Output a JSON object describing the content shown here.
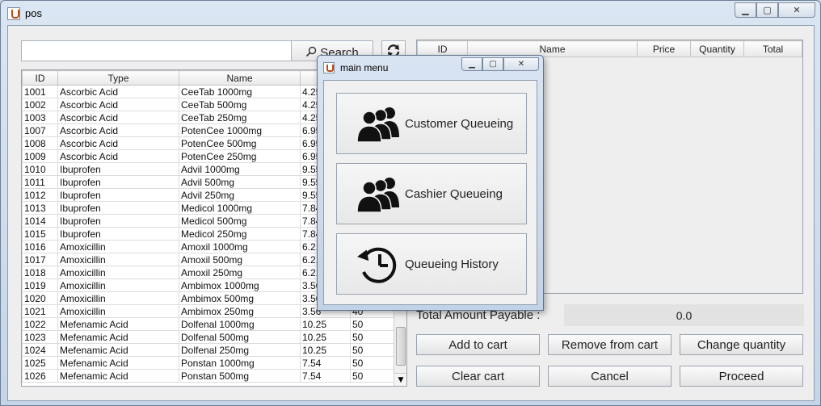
{
  "window": {
    "title": "pos"
  },
  "search": {
    "value": "",
    "button_label": "Search"
  },
  "products": {
    "columns": [
      "ID",
      "Type",
      "Name",
      "",
      ""
    ],
    "rows": [
      [
        "1001",
        "Ascorbic Acid",
        "CeeTab 1000mg",
        "4.25",
        ""
      ],
      [
        "1002",
        "Ascorbic Acid",
        "CeeTab 500mg",
        "4.25",
        ""
      ],
      [
        "1003",
        "Ascorbic Acid",
        "CeeTab 250mg",
        "4.25",
        ""
      ],
      [
        "1007",
        "Ascorbic Acid",
        "PotenCee 1000mg",
        "6.95",
        ""
      ],
      [
        "1008",
        "Ascorbic Acid",
        "PotenCee 500mg",
        "6.95",
        ""
      ],
      [
        "1009",
        "Ascorbic Acid",
        "PotenCee 250mg",
        "6.95",
        ""
      ],
      [
        "1010",
        "Ibuprofen",
        "Advil 1000mg",
        "9.55",
        ""
      ],
      [
        "1011",
        "Ibuprofen",
        "Advil 500mg",
        "9.55",
        ""
      ],
      [
        "1012",
        "Ibuprofen",
        "Advil 250mg",
        "9.55",
        ""
      ],
      [
        "1013",
        "Ibuprofen",
        "Medicol 1000mg",
        "7.84",
        ""
      ],
      [
        "1014",
        "Ibuprofen",
        "Medicol 500mg",
        "7.84",
        ""
      ],
      [
        "1015",
        "Ibuprofen",
        "Medicol 250mg",
        "7.84",
        ""
      ],
      [
        "1016",
        "Amoxicillin",
        "Amoxil 1000mg",
        "6.21",
        ""
      ],
      [
        "1017",
        "Amoxicillin",
        "Amoxil 500mg",
        "6.21",
        ""
      ],
      [
        "1018",
        "Amoxicillin",
        "Amoxil 250mg",
        "6.21",
        ""
      ],
      [
        "1019",
        "Amoxicillin",
        "Ambimox 1000mg",
        "3.56",
        ""
      ],
      [
        "1020",
        "Amoxicillin",
        "Ambimox 500mg",
        "3.56",
        ""
      ],
      [
        "1021",
        "Amoxicillin",
        "Ambimox 250mg",
        "3.56",
        "40"
      ],
      [
        "1022",
        "Mefenamic Acid",
        "Dolfenal 1000mg",
        "10.25",
        "50"
      ],
      [
        "1023",
        "Mefenamic Acid",
        "Dolfenal 500mg",
        "10.25",
        "50"
      ],
      [
        "1024",
        "Mefenamic Acid",
        "Dolfenal 250mg",
        "10.25",
        "50"
      ],
      [
        "1025",
        "Mefenamic Acid",
        "Ponstan 1000mg",
        "7.54",
        "50"
      ],
      [
        "1026",
        "Mefenamic Acid",
        "Ponstan 500mg",
        "7.54",
        "50"
      ]
    ]
  },
  "cart": {
    "columns": [
      "ID",
      "Name",
      "Price",
      "Quantity",
      "Total"
    ],
    "rows": []
  },
  "total": {
    "label": "Total Amount Payable :",
    "value": "0.0"
  },
  "actions": {
    "add": "Add to cart",
    "remove": "Remove from cart",
    "change": "Change quantity",
    "clear": "Clear cart",
    "cancel": "Cancel",
    "proceed": "Proceed"
  },
  "dialog": {
    "title": "main menu",
    "items": [
      {
        "label": "Customer Queueing",
        "icon": "people-icon"
      },
      {
        "label": "Cashier Queueing",
        "icon": "people-icon"
      },
      {
        "label": "Queueing History",
        "icon": "history-icon"
      }
    ]
  }
}
